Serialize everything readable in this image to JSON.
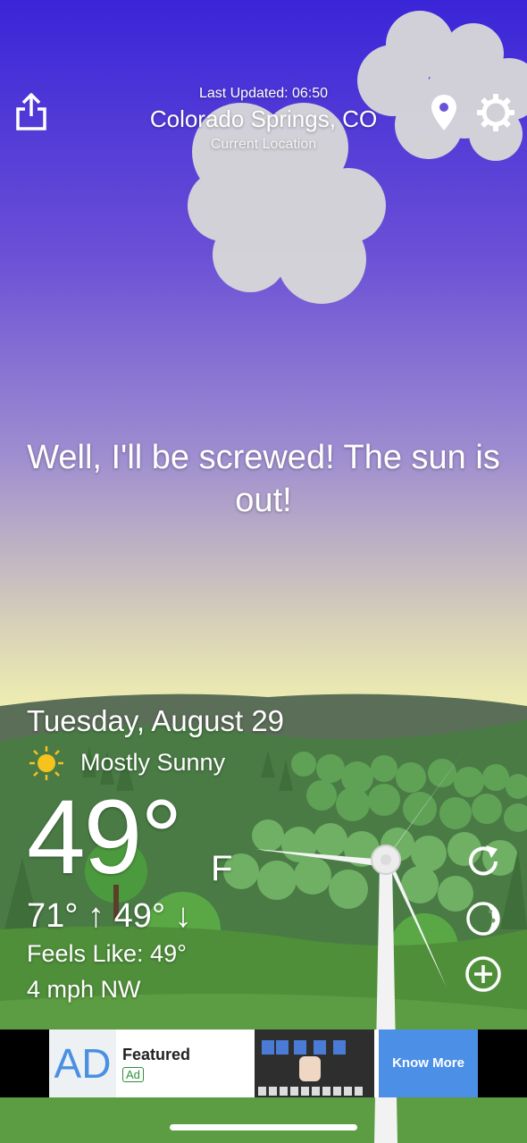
{
  "header": {
    "last_updated": "Last Updated: 06:50",
    "city": "Colorado Springs, CO",
    "location_label": "Current Location"
  },
  "icons": {
    "share": "share-icon",
    "location": "location-pin-icon",
    "settings": "gear-icon",
    "refresh": "refresh-icon",
    "moon": "moon-phase-icon",
    "add": "plus-circle-icon",
    "condition": "sun-icon"
  },
  "quote": "Well, I'll be screwed! The sun is out!",
  "forecast": {
    "date": "Tuesday, August 29",
    "condition": "Mostly Sunny",
    "temperature": "49°",
    "unit": "F",
    "high_low": "71° ↑ 49° ↓",
    "feels_like": "Feels Like: 49°",
    "wind": "4 mph NW"
  },
  "ad": {
    "logo_text": "AD",
    "featured_label": "Featured",
    "ad_tag": "Ad",
    "cta_label": "Know More"
  },
  "colors": {
    "sky_top": "#3a25d8",
    "sky_horizon": "#fbfbb2",
    "grass": "#4f8f3a",
    "ad_cta": "#4c8fe6"
  }
}
